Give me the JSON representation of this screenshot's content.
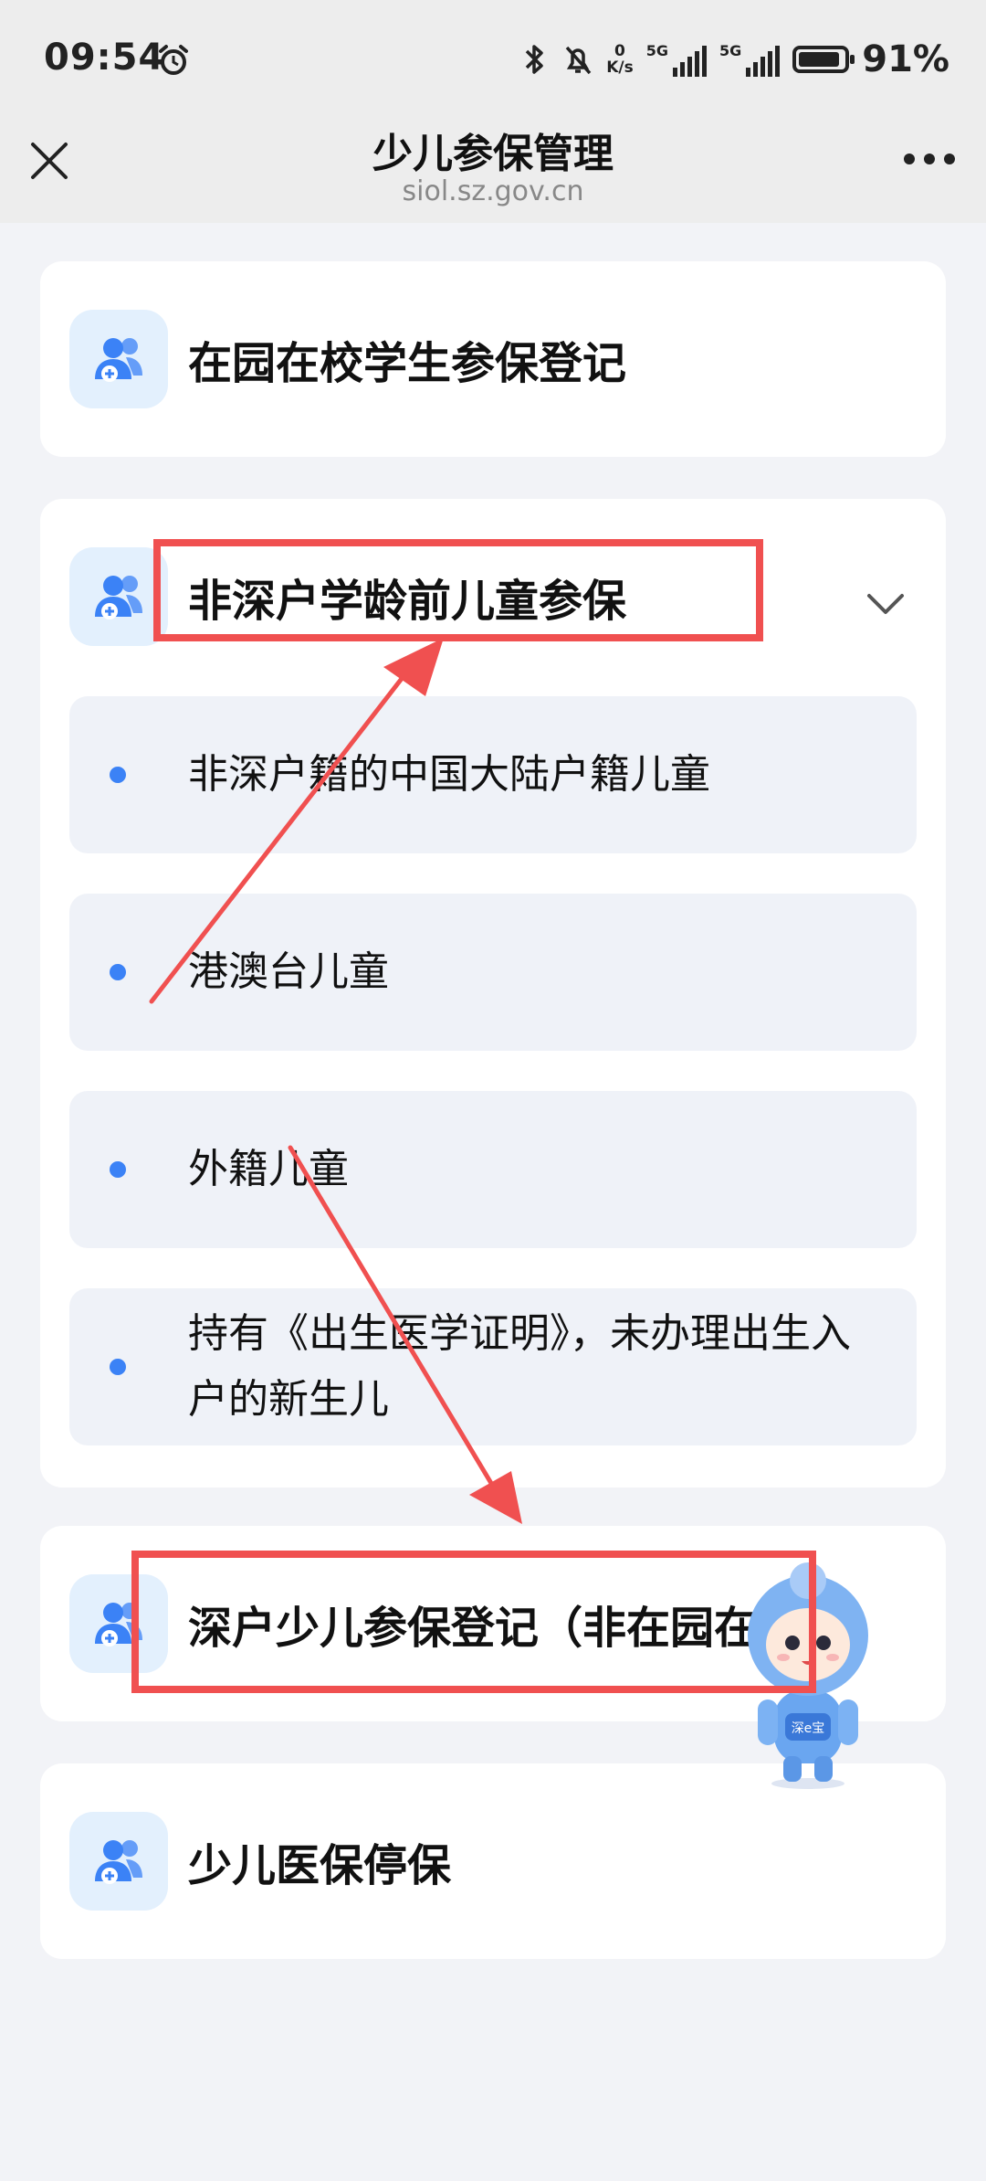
{
  "status": {
    "time": "09:54",
    "net_speed_top": "0",
    "net_speed_bottom": "K/s",
    "sim1": "5G",
    "sim2": "5G",
    "battery": "91%",
    "battery_level": 0.91
  },
  "header": {
    "title": "少儿参保管理",
    "url": "siol.sz.gov.cn"
  },
  "cards": {
    "c1": {
      "title": "在园在校学生参保登记"
    },
    "c2": {
      "title": "非深户学龄前儿童参保",
      "items": [
        "非深户籍的中国大陆户籍儿童",
        "港澳台儿童",
        "外籍儿童",
        "持有《出生医学证明》，未办理出生入户的新生儿"
      ]
    },
    "c3": {
      "title": "深户少儿参保登记（非在园在"
    },
    "c4": {
      "title": "少儿医保停保"
    }
  },
  "mascot": {
    "badge": "深e宝"
  },
  "colors": {
    "accent": "#3b82f6",
    "annotation_red": "#f05050",
    "icon_bg": "#e3f0fd"
  },
  "icons": [
    "alarm-icon",
    "bluetooth-icon",
    "mute-icon",
    "signal-icon",
    "battery-icon",
    "close-icon",
    "more-icon",
    "users-icon",
    "chevron-down-icon"
  ]
}
